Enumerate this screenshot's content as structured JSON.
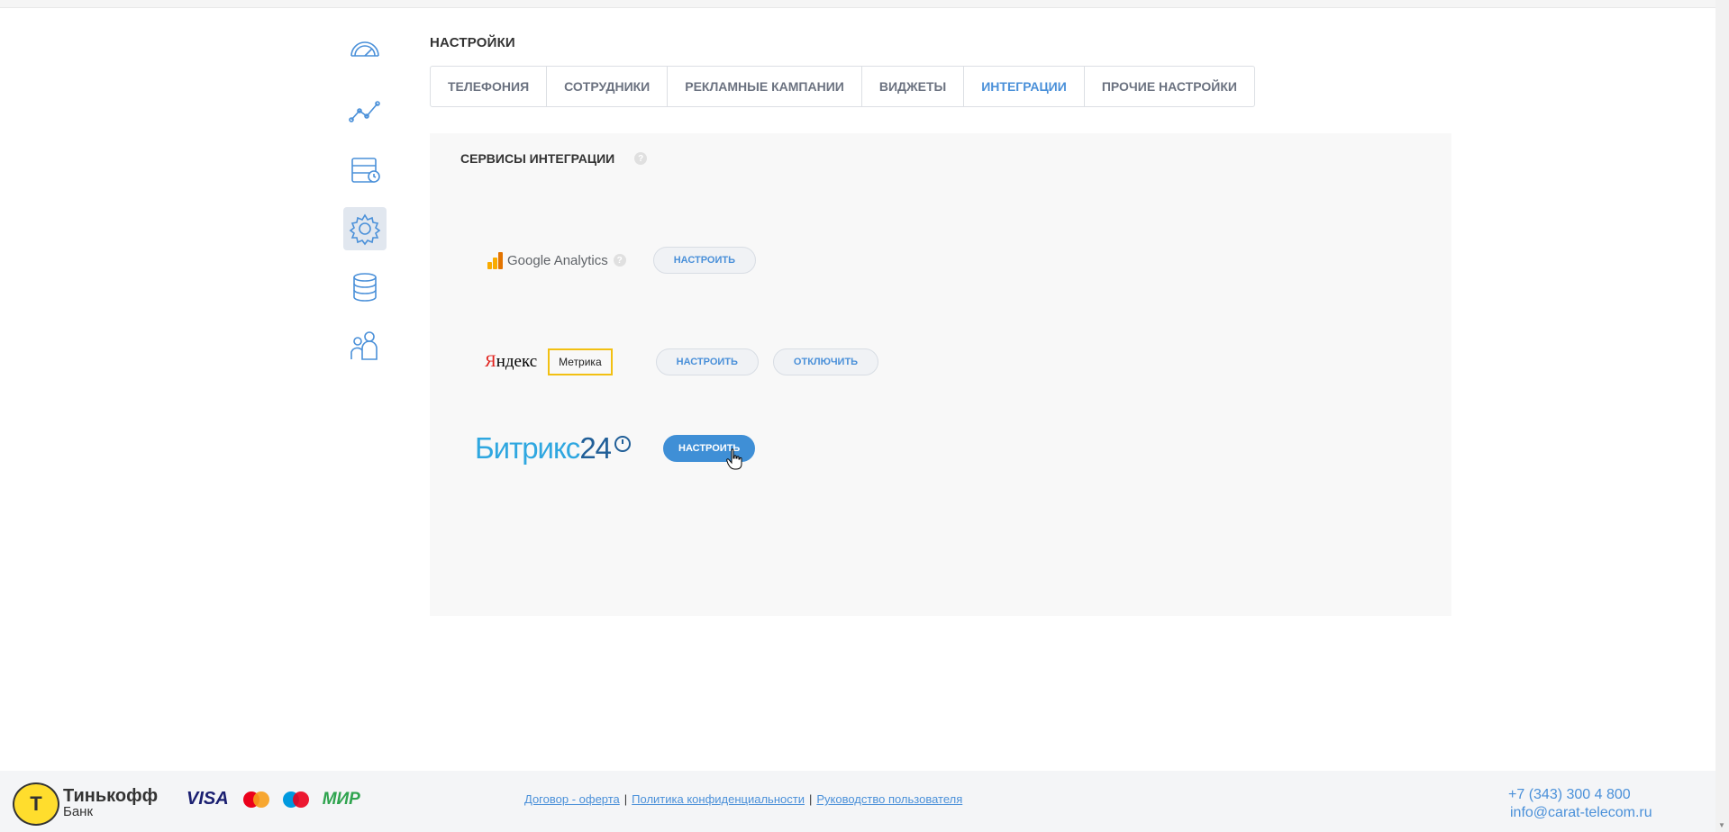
{
  "page": {
    "title": "НАСТРОЙКИ"
  },
  "sidebar": {
    "items": [
      {
        "icon": "dashboard-gauge-icon",
        "active": false
      },
      {
        "icon": "analytics-chart-icon",
        "active": false
      },
      {
        "icon": "calls-history-icon",
        "active": false
      },
      {
        "icon": "settings-gear-icon",
        "active": true
      },
      {
        "icon": "database-icon",
        "active": false
      },
      {
        "icon": "users-group-icon",
        "active": false
      }
    ]
  },
  "tabs": [
    {
      "label": "ТЕЛЕФОНИЯ",
      "active": false
    },
    {
      "label": "СОТРУДНИКИ",
      "active": false
    },
    {
      "label": "РЕКЛАМНЫЕ КАМПАНИИ",
      "active": false
    },
    {
      "label": "ВИДЖЕТЫ",
      "active": false
    },
    {
      "label": "ИНТЕГРАЦИИ",
      "active": true
    },
    {
      "label": "ПРОЧИЕ НАСТРОЙКИ",
      "active": false
    }
  ],
  "integrations": {
    "title": "СЕРВИСЫ ИНТЕГРАЦИИ",
    "help": "?",
    "google": {
      "logo_text": "Google Analytics",
      "help": "?",
      "configure": "НАСТРОИТЬ"
    },
    "yandex": {
      "logo_text": "Яндекс",
      "badge": "Метрика",
      "configure": "НАСТРОИТЬ",
      "disable": "ОТКЛЮЧИТЬ"
    },
    "bitrix": {
      "logo_text": "Битрикс",
      "logo_num": "24",
      "configure": "НАСТРОИТЬ"
    }
  },
  "footer": {
    "bank_name": "Тинькофф",
    "bank_sub": "Банк",
    "payments": {
      "visa": "VISA",
      "mir": "МИР"
    },
    "links": [
      "Договор - оферта",
      "Политика конфиденциальности",
      "Руководство пользователя"
    ],
    "separator": "|",
    "phone": "+7 (343) 300 4 800",
    "email": "info@carat-telecom.ru"
  },
  "colors": {
    "accent": "#4a90d9",
    "primary_button": "#3f8fd6",
    "active_nav": "#e1e7ef",
    "panel_bg": "#f8f8f8"
  }
}
